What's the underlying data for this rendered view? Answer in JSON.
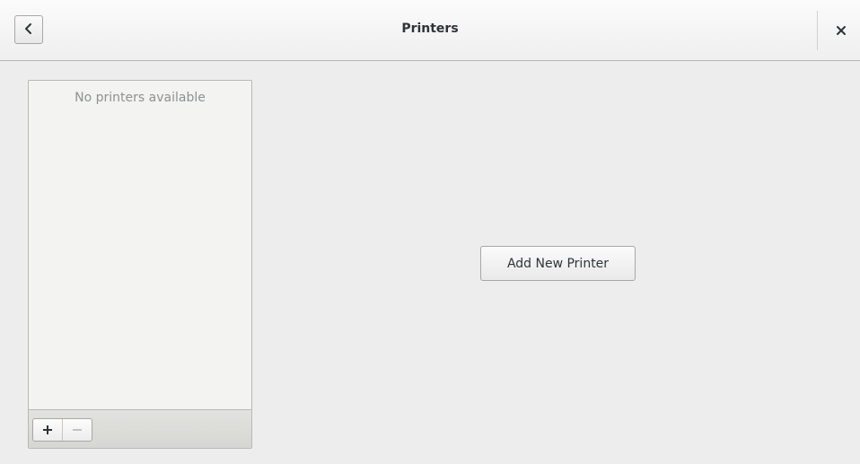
{
  "window": {
    "title": "Printers",
    "back_icon": "back-arrow-icon",
    "close_icon": "close-icon"
  },
  "printer_list": {
    "empty_text": "No printers available",
    "add_icon": "plus-icon",
    "remove_icon": "minus-icon"
  },
  "main": {
    "add_printer_label": "Add New Printer"
  },
  "colors": {
    "window_bg": "#ededed",
    "headerbar_bg": "#f4f4f4",
    "list_bg": "#f3f3f1",
    "placeholder_text": "#8e9194",
    "text": "#2e3436",
    "disabled_icon": "#b0b0b0"
  }
}
